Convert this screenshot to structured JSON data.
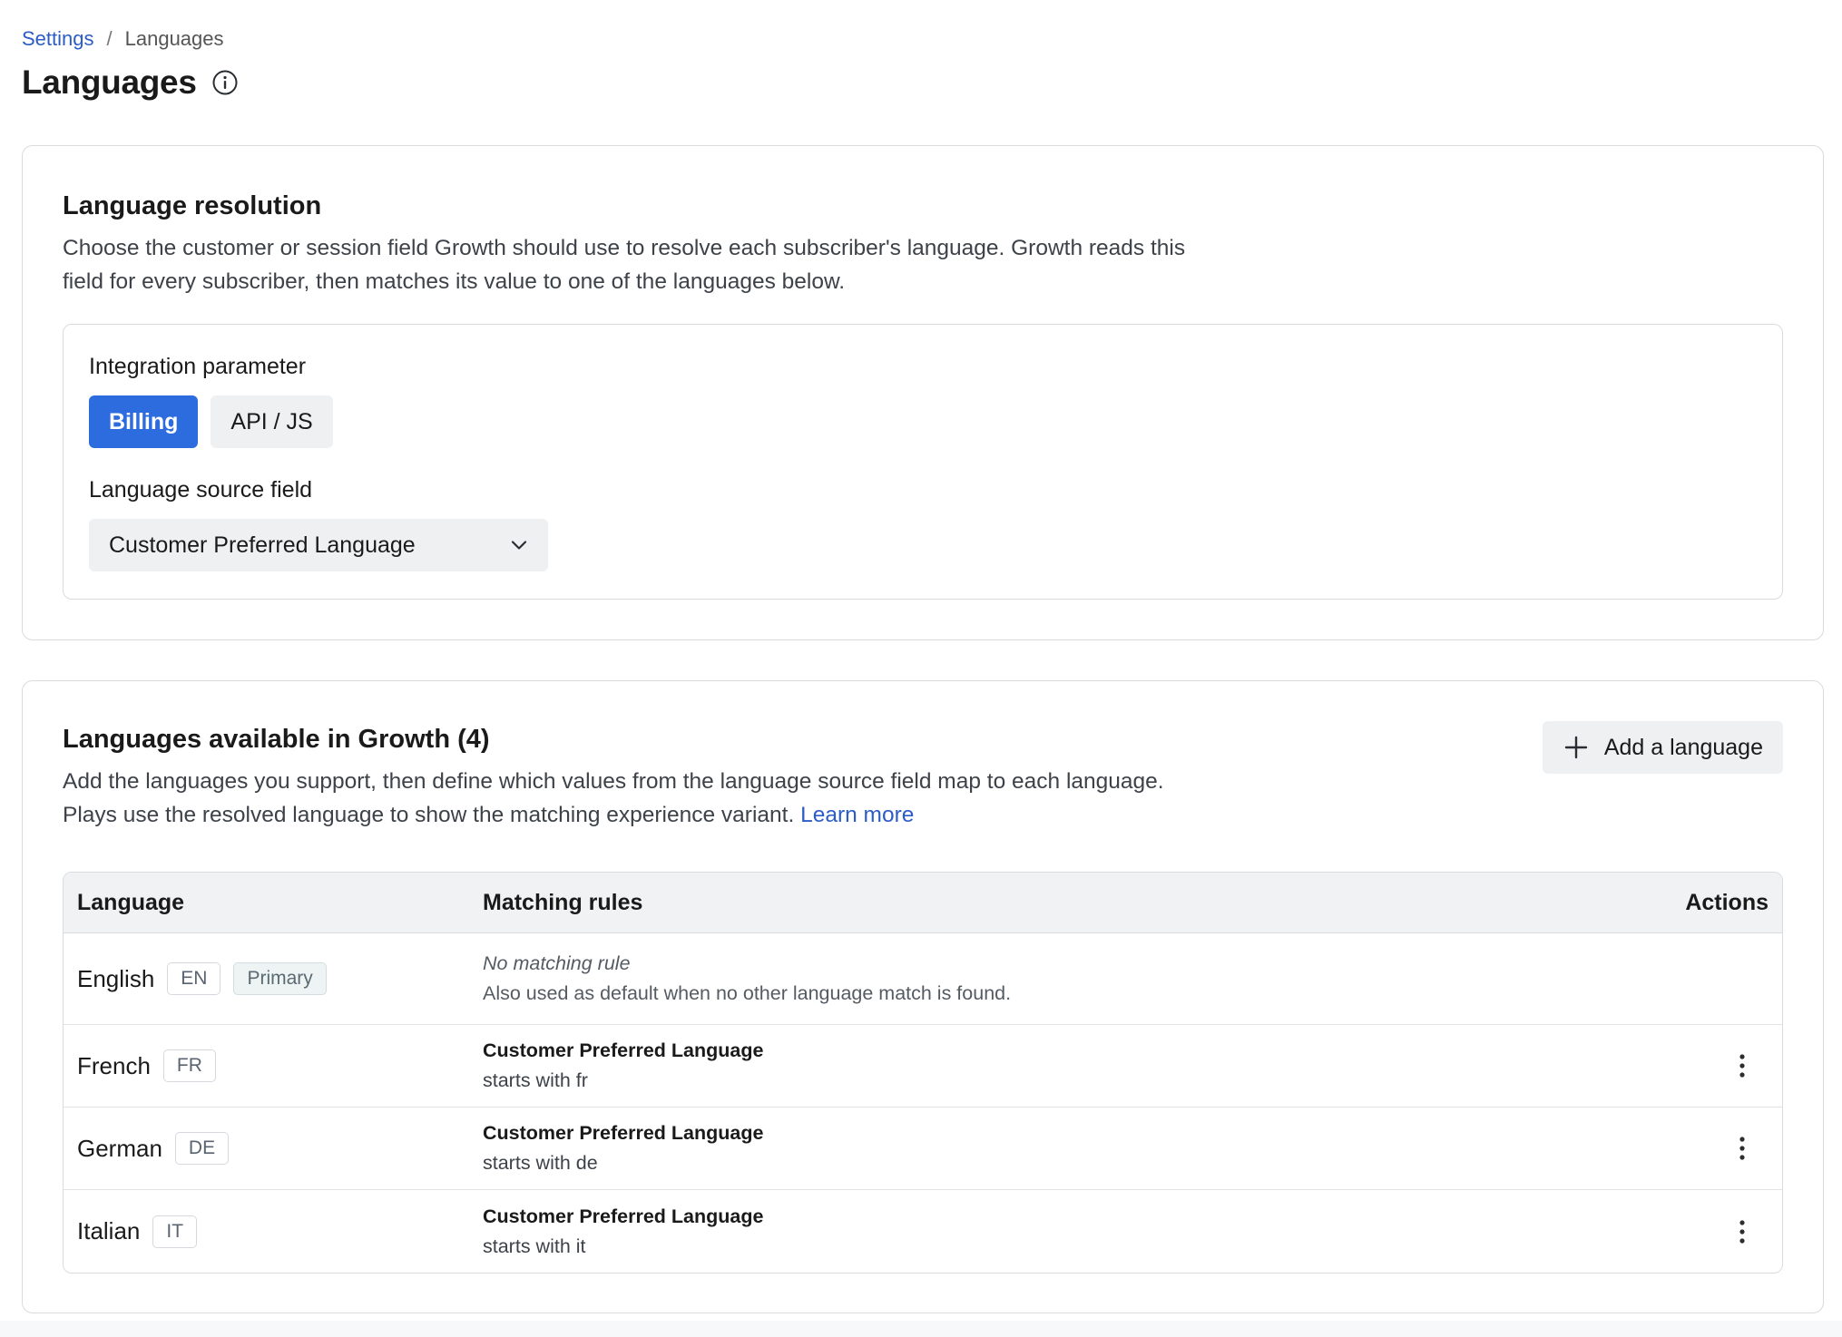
{
  "breadcrumb": {
    "parent": "Settings",
    "separator": "/",
    "current": "Languages"
  },
  "page": {
    "title": "Languages",
    "info_icon": "info-icon"
  },
  "resolution": {
    "heading": "Language resolution",
    "description": "Choose the customer or session field Growth should use to resolve each subscriber's language. Growth reads this field for every subscriber, then matches its value to one of the languages below.",
    "integration_label": "Integration parameter",
    "options": [
      {
        "label": "Billing",
        "active": true
      },
      {
        "label": "API / JS",
        "active": false
      }
    ],
    "source_label": "Language source field",
    "source_value": "Customer Preferred Language"
  },
  "languages": {
    "heading": "Languages available in Growth (4)",
    "description": "Add the languages you support, then define which values from the language source field map to each language. Plays use the resolved language to show the matching experience variant.",
    "learn_more": "Learn more",
    "add_button": "Add a language",
    "columns": {
      "language": "Language",
      "rules": "Matching rules",
      "actions": "Actions"
    },
    "rows": [
      {
        "name": "English",
        "code": "EN",
        "badge": "Primary",
        "rule_title": "No matching rule",
        "rule_detail": "Also used as default when no other language match is found."
      },
      {
        "name": "French",
        "code": "FR",
        "rule_title": "Customer Preferred Language",
        "rule_detail": "starts with fr"
      },
      {
        "name": "German",
        "code": "DE",
        "rule_title": "Customer Preferred Language",
        "rule_detail": "starts with de"
      },
      {
        "name": "Italian",
        "code": "IT",
        "rule_title": "Customer Preferred Language",
        "rule_detail": "starts with it"
      }
    ]
  },
  "colors": {
    "accent": "#2d6cdf",
    "link": "#2c5cc5",
    "border": "#d9dbde"
  }
}
